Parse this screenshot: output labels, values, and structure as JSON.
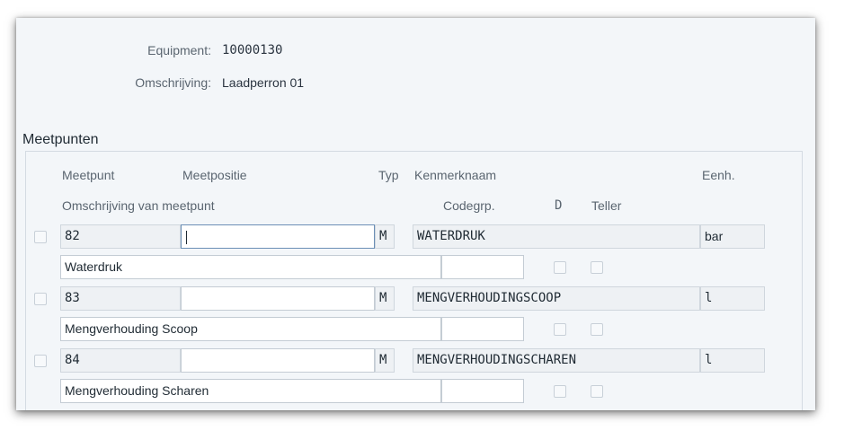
{
  "header": {
    "equipment_label": "Equipment:",
    "equipment_value": "10000130",
    "description_label": "Omschrijving:",
    "description_value": "Laadperron 01"
  },
  "section": {
    "title": "Meetpunten"
  },
  "columns": {
    "meetpunt": "Meetpunt",
    "meetpositie": "Meetpositie",
    "typ": "Typ",
    "kenmerknaam": "Kenmerknaam",
    "eenh": "Eenh.",
    "omschrijving": "Omschrijving van meetpunt",
    "codegrp": "Codegrp.",
    "d": "D",
    "teller": "Teller"
  },
  "rows": [
    {
      "meetpunt": "82",
      "meetpositie": "",
      "typ": "M",
      "kenmerknaam": "WATERDRUK",
      "eenheid": "bar",
      "omschrijving": "Waterdruk",
      "codegrp": ""
    },
    {
      "meetpunt": "83",
      "meetpositie": "",
      "typ": "M",
      "kenmerknaam": "MENGVERHOUDINGSCOOP",
      "eenheid": "l",
      "omschrijving": "Mengverhouding Scoop",
      "codegrp": ""
    },
    {
      "meetpunt": "84",
      "meetpositie": "",
      "typ": "M",
      "kenmerknaam": "MENGVERHOUDINGSCHAREN",
      "eenheid": "l",
      "omschrijving": "Mengverhouding Scharen",
      "codegrp": ""
    }
  ]
}
